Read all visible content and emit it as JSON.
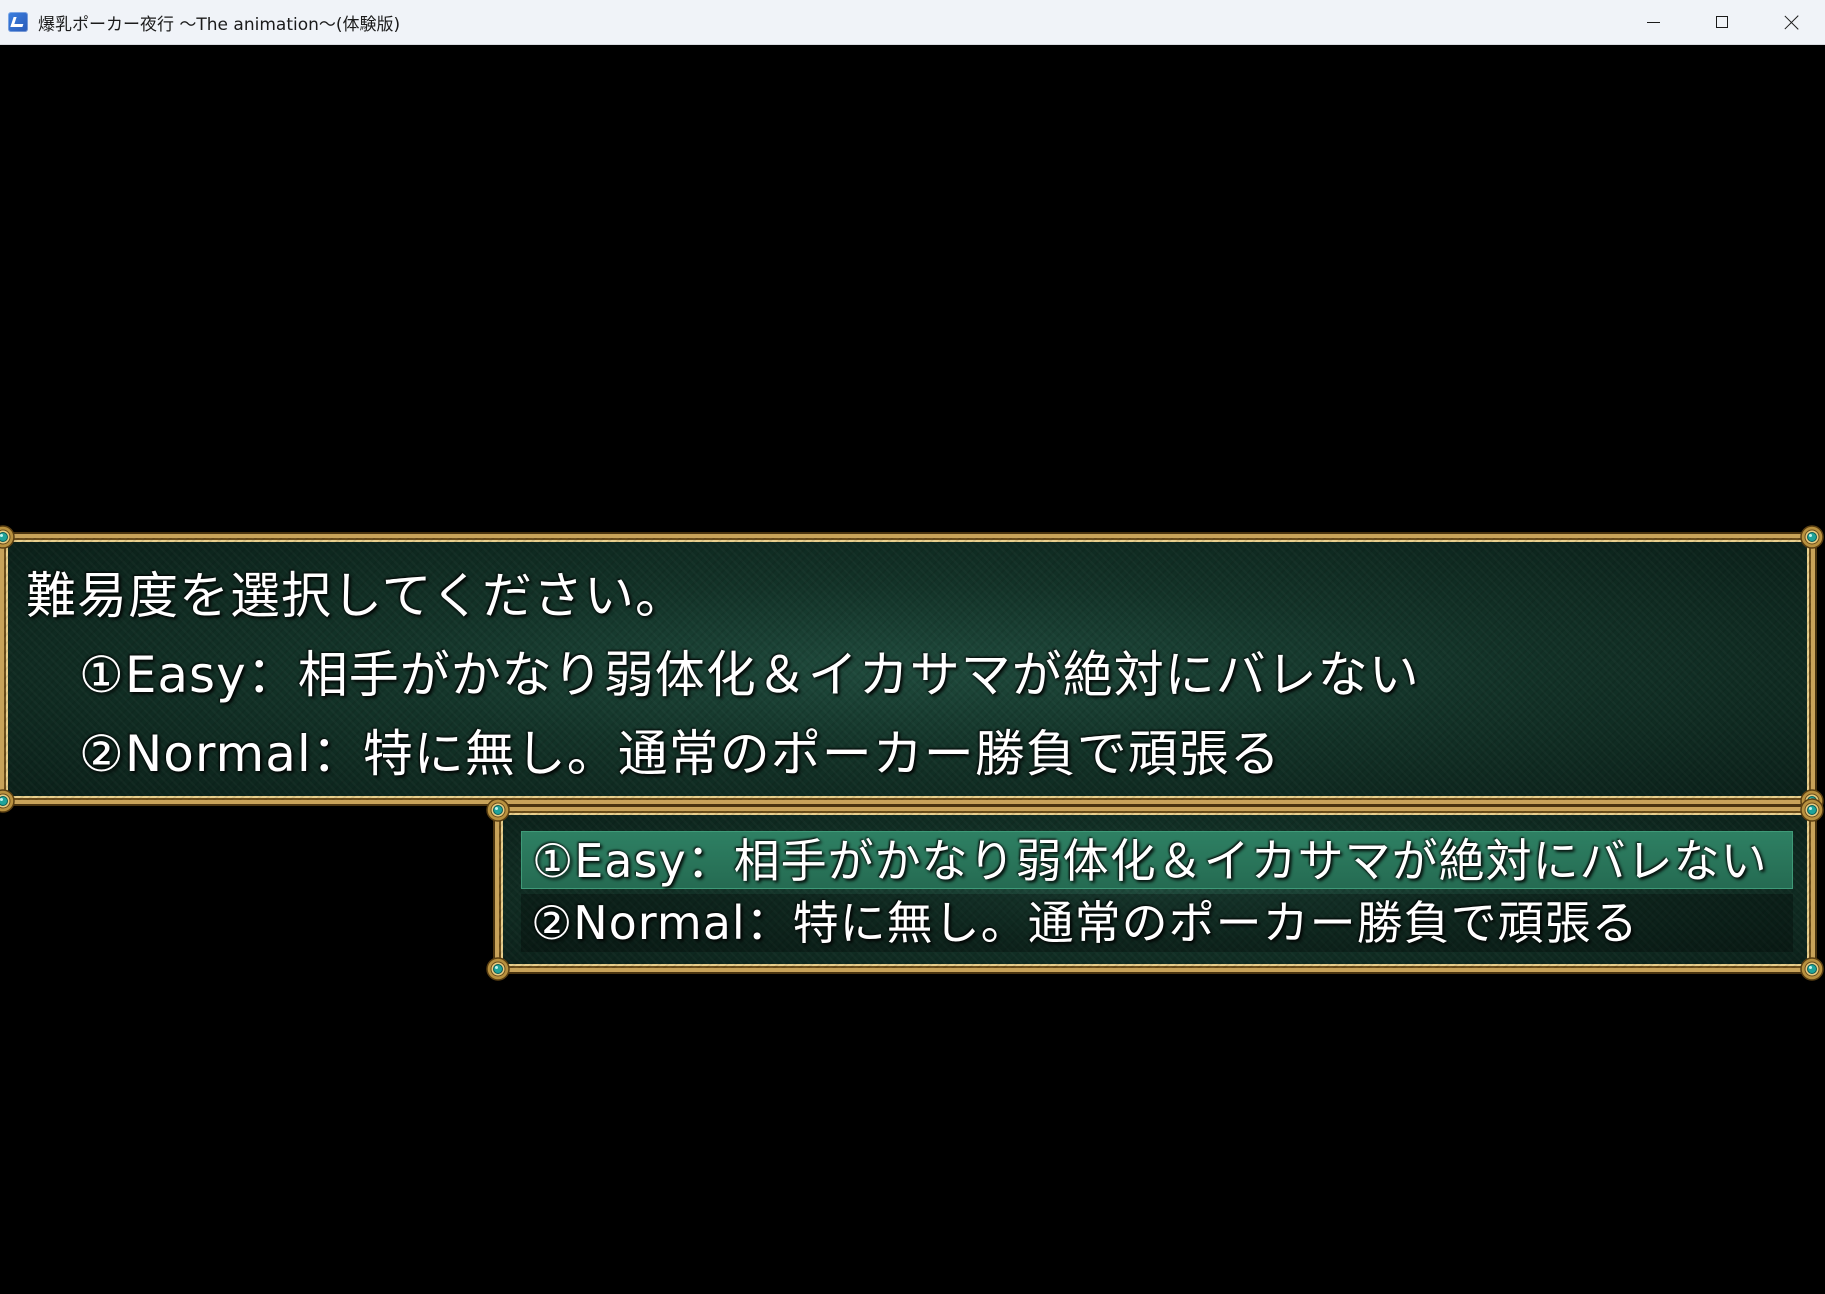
{
  "window": {
    "title": "爆乳ポーカー夜行 ～The animation～(体験版)",
    "controls": {
      "minimize_icon": "minimize-icon",
      "maximize_icon": "maximize-icon",
      "close_icon": "close-icon"
    }
  },
  "message": {
    "lines": [
      "難易度を選択してください。",
      "①Easy：相手がかなり弱体化＆イカサマが絶対にバレない",
      "②Normal：特に無し。通常のポーカー勝負で頑張る"
    ]
  },
  "choices": {
    "selected_index": 0,
    "items": [
      "①Easy：相手がかなり弱体化＆イカサマが絶対にバレない",
      "②Normal：特に無し。通常のポーカー勝負で頑張る"
    ]
  },
  "colors": {
    "frame_gold": "#c8a35a",
    "window_green": "#133328",
    "highlight_green": "#2e8063",
    "text": "#ffffff"
  }
}
